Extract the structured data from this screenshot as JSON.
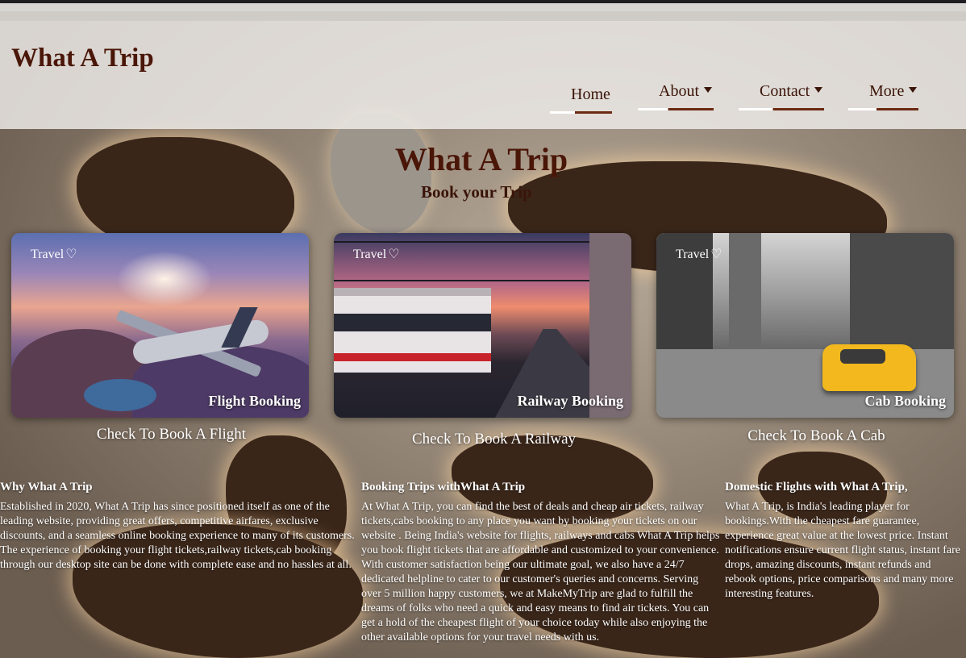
{
  "header": {
    "logo": "What A Trip",
    "nav": [
      {
        "label": "Home",
        "dropdown": false
      },
      {
        "label": "About",
        "dropdown": true
      },
      {
        "label": "Contact",
        "dropdown": true
      },
      {
        "label": "More",
        "dropdown": true
      }
    ]
  },
  "hero": {
    "title": "What A Trip",
    "subtitle": "Book your Trip"
  },
  "cards": [
    {
      "tag": "Travel",
      "title": "Flight Booking",
      "caption": "Check To Book A Flight"
    },
    {
      "tag": "Travel",
      "title": "Railway Booking",
      "caption": "Check To Book A Railway"
    },
    {
      "tag": "Travel",
      "title": "Cab Booking",
      "caption": "Check To Book A Cab"
    }
  ],
  "columns": [
    {
      "heading": "Why What A Trip",
      "body": "Established in 2020, What A Trip has since positioned itself as one of the leading website, providing great offers, competitive airfares, exclusive discounts, and a seamless online booking experience to many of its customers. The experience of booking your flight tickets,railway tickets,cab booking through our desktop site can be done with complete ease and no hassles at all."
    },
    {
      "heading": "Booking Trips withWhat A Trip",
      "body": "At What A Trip, you can find the best of deals and cheap air tickets, railway tickets,cabs booking to any place you want by booking your tickets on our website . Being India's website for flights, railways and cabs What A Trip helps you book flight tickets that are affordable and customized to your convenience. With customer satisfaction being our ultimate goal, we also have a 24/7 dedicated helpline to cater to our customer's queries and concerns. Serving over 5 million happy customers, we at MakeMyTrip are glad to fulfill the dreams of folks who need a quick and easy means to find air tickets. You can get a hold of the cheapest flight of your choice today while also enjoying the other available options for your travel needs with us."
    },
    {
      "heading": "Domestic Flights with What A Trip,",
      "body": "What A Trip, is India's leading player for bookings.With the cheapest fare guarantee, experience great value at the lowest price. Instant notifications ensure current flight status, instant fare drops, amazing discounts, instant refunds and rebook options, price comparisons and many more interesting features."
    }
  ],
  "icons": {
    "tag_icon": "heart-outline-icon",
    "dropdown_icon": "caret-down-icon"
  },
  "colors": {
    "brand": "#4a1608",
    "header_bg": "#f0eeec"
  }
}
